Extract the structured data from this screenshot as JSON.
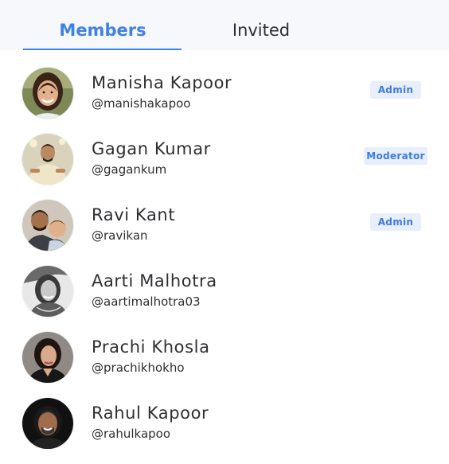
{
  "tabs": {
    "members": "Members",
    "invited": "Invited"
  },
  "members": [
    {
      "name": "Manisha Kapoor",
      "handle": "@manishakapoo",
      "role": "Admin"
    },
    {
      "name": "Gagan Kumar",
      "handle": "@gagankum",
      "role": "Moderator"
    },
    {
      "name": "Ravi Kant",
      "handle": "@ravikan",
      "role": "Admin"
    },
    {
      "name": "Aarti Malhotra",
      "handle": "@aartimalhotra03",
      "role": ""
    },
    {
      "name": "Prachi Khosla",
      "handle": "@prachikhokho",
      "role": ""
    },
    {
      "name": "Rahul Kapoor",
      "handle": "@rahulkapoo",
      "role": ""
    }
  ],
  "colors": {
    "accent": "#3f82e6",
    "badge_bg": "#e7eefc",
    "tab_bar_bg": "#f7f8fc"
  }
}
